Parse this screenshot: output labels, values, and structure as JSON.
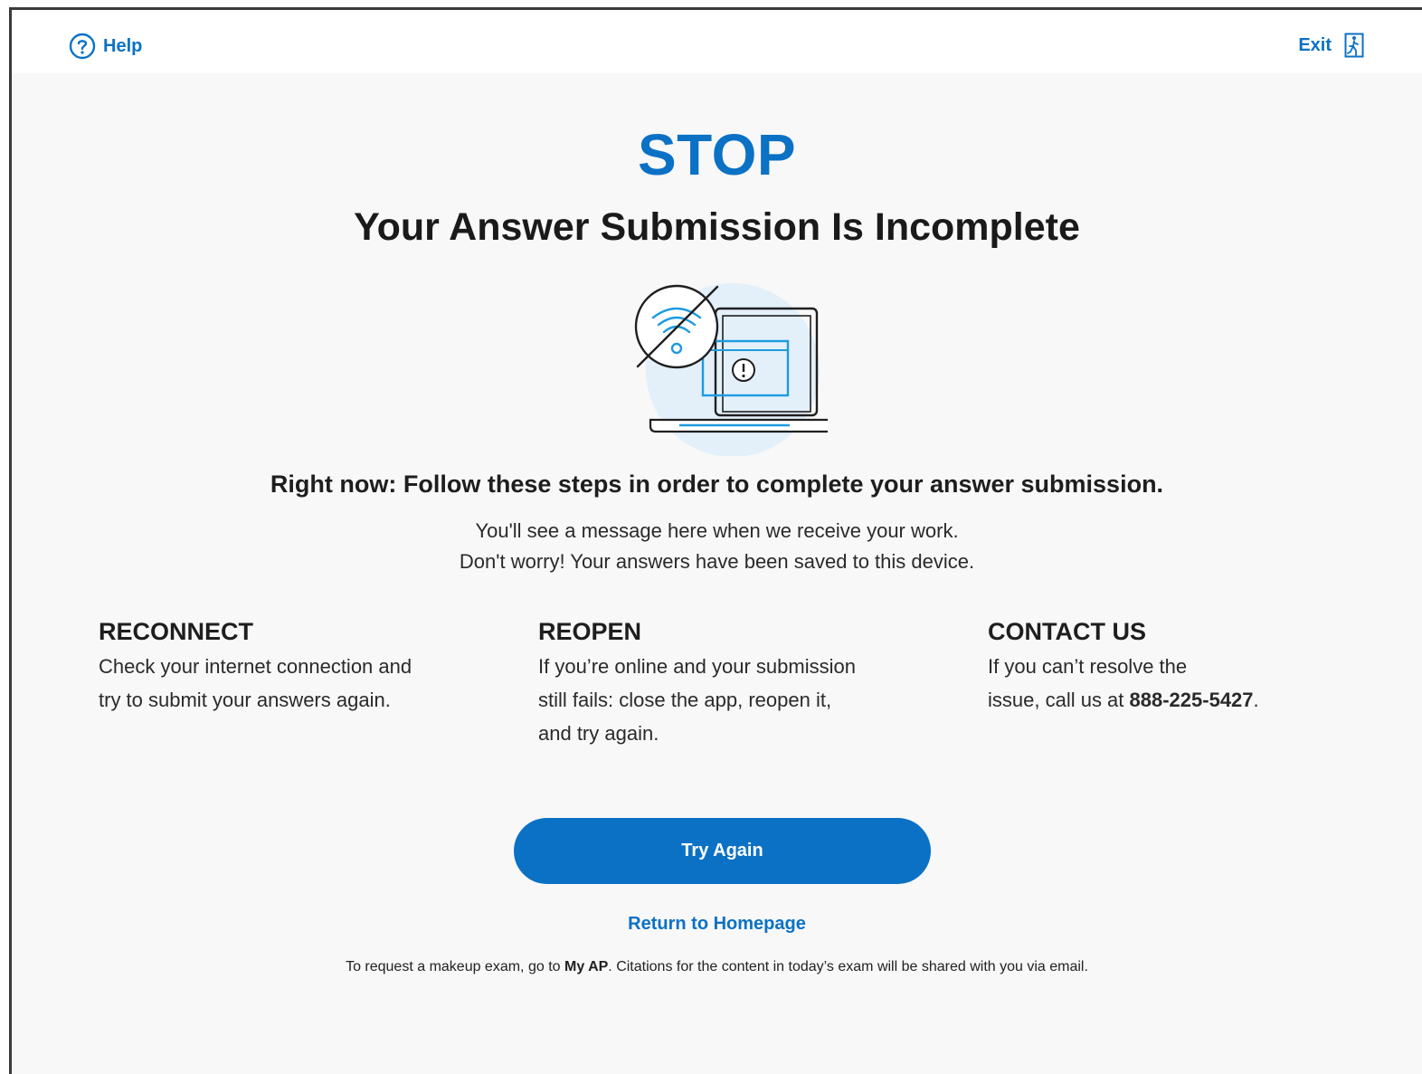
{
  "header": {
    "help_label": "Help",
    "exit_label": "Exit"
  },
  "main": {
    "stop": "STOP",
    "title": "Your Answer Submission Is Incomplete",
    "lead": "Right now: Follow these steps in order to complete your answer submission.",
    "sub_line1": "You'll see a message here when we receive your work.",
    "sub_line2": "Don't worry! Your answers have been saved to this device."
  },
  "steps": {
    "reconnect": {
      "heading": "RECONNECT",
      "line1": "Check your internet connection and",
      "line2": "try to submit your answers again."
    },
    "reopen": {
      "heading": "REOPEN",
      "line1": "If you’re online and your submission",
      "line2": "still fails: close the app, reopen it,",
      "line3": "and try again."
    },
    "contact": {
      "heading": "CONTACT US",
      "line1": "If you can’t resolve the",
      "line2_prefix": "issue, call us at ",
      "phone": "888-225-5427",
      "line2_suffix": "."
    }
  },
  "actions": {
    "try_again": "Try Again",
    "return_home": "Return to Homepage"
  },
  "footer": {
    "prefix": "To request a makeup exam, go to ",
    "link": "My AP",
    "suffix": ". Citations for the content in today’s exam will be shared with you via email."
  },
  "colors": {
    "accent": "#0b71c5",
    "background": "#f8f8f8",
    "illustration_circle": "#e3f0fa",
    "text": "#1e1e1e"
  },
  "icons": {
    "help": "question-circle-icon",
    "exit": "exit-door-icon",
    "illustration": "no-wifi-laptop-illustration"
  }
}
